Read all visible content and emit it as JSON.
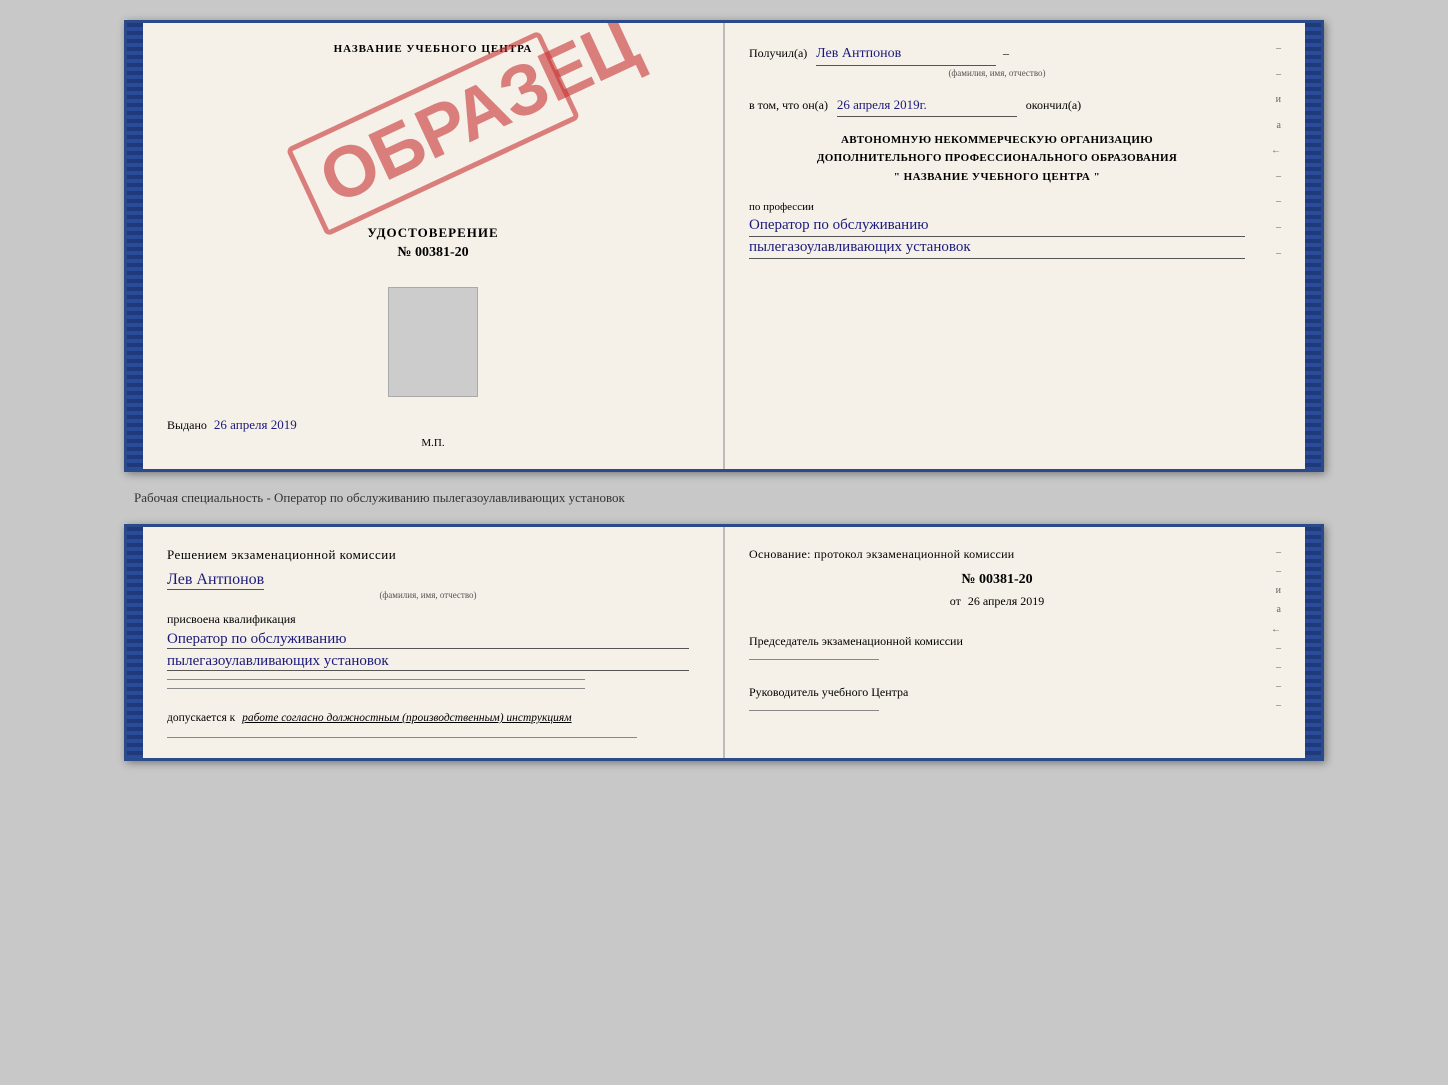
{
  "topSpread": {
    "leftPage": {
      "schoolName": "НАЗВАНИЕ УЧЕБНОГО ЦЕНТРА",
      "obrazecLabel": "ОБРАЗЕЦ",
      "certLabel": "УДОСТОВЕРЕНИЕ",
      "certNumber": "№ 00381-20",
      "issuedLabel": "Выдано",
      "issuedDate": "26 апреля 2019",
      "mpLabel": "М.П."
    },
    "rightPage": {
      "receivedLabel": "Получил(а)",
      "receivedName": "Лев Антпонов",
      "fioLabel": "(фамилия, имя, отчество)",
      "inThatLabel": "в том, что он(а)",
      "completedDate": "26 апреля 2019г.",
      "completedLabel": "окончил(а)",
      "orgLine1": "АВТОНОМНУЮ НЕКОММЕРЧЕСКУЮ ОРГАНИЗАЦИЮ",
      "orgLine2": "ДОПОЛНИТЕЛЬНОГО ПРОФЕССИОНАЛЬНОГО ОБРАЗОВАНИЯ",
      "orgLine3": "\"   НАЗВАНИЕ УЧЕБНОГО ЦЕНТРА   \"",
      "professionLabel": "по профессии",
      "profLine1": "Оператор по обслуживанию",
      "profLine2": "пылегазоулавливающих установок"
    }
  },
  "specialtyLine": "Рабочая специальность - Оператор по обслуживанию пылегазоулавливающих установок",
  "bottomSpread": {
    "leftPage": {
      "commissionDecision": "Решением экзаменационной комиссии",
      "personName": "Лев Антпонов",
      "fioLabel": "(фамилия, имя, отчество)",
      "qualificationAssigned": "присвоена квалификация",
      "qualLine1": "Оператор по обслуживанию",
      "qualLine2": "пылегазоулавливающих установок",
      "accessText": "допускается к",
      "accessItalic": "работе согласно должностным (производственным) инструкциям"
    },
    "rightPage": {
      "basisLabel": "Основание: протокол экзаменационной комиссии",
      "protocolNumber": "№ 00381-20",
      "fromLabel": "от",
      "fromDate": "26 апреля 2019",
      "chairLabel": "Председатель экзаменационной комиссии",
      "centerHeadLabel": "Руководитель учебного Центра"
    }
  },
  "sideMarks": {
    "items": [
      "–",
      "–",
      "и",
      "а",
      "←",
      "–",
      "–",
      "–",
      "–"
    ]
  }
}
